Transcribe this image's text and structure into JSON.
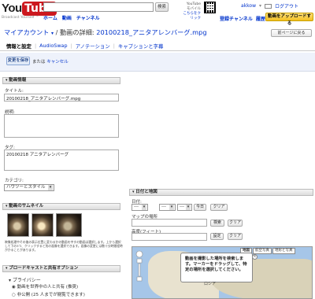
{
  "header": {
    "logo_you": "You",
    "logo_tube": "Tube",
    "logo_sub": "Broadcast Yourself ™",
    "search_button": "検索",
    "nav": [
      "ホーム",
      "動画",
      "チャンネル"
    ],
    "mobile_line1": "YouTube モバイル",
    "mobile_line2": "こちらをクリック",
    "username": "akkow",
    "logout": "ログアウト",
    "sub_nav": [
      "登録チャンネル",
      "履歴"
    ],
    "upload_button": "動画をアップロードする"
  },
  "title": {
    "account": "マイアカウント",
    "separator": "/",
    "section": "動画の詳細:",
    "filename": "20100218_アニタアレンバーグ.mpg",
    "back_button": "前ページに戻る"
  },
  "tabs": [
    {
      "label": "情報と設定",
      "active": true
    },
    {
      "label": "AudioSwap",
      "active": false
    },
    {
      "label": "アノテーション",
      "active": false
    },
    {
      "label": "キャプションと字幕",
      "active": false
    }
  ],
  "save": {
    "button": "変更を保存",
    "or": "または",
    "cancel": "キャンセル"
  },
  "video_info": {
    "header": "動画情報",
    "title_label": "タイトル:",
    "title_value": "20100218_アニタアレンバーグ.mpg",
    "desc_label": "説明:",
    "desc_value": "",
    "tags_label": "タグ:",
    "tags_value": "20100218 アニタアレンバーグ",
    "category_label": "カテゴリ:",
    "category_value": "ハウツーとスタイル"
  },
  "thumbnail": {
    "header": "動画のサムネイル",
    "note": "映像処理中その後の表示位置に変わるかの動画を中すの動画は選択します。上から選択して下の3つ、クリックすると別の画像を選択できます。画像の変更には数十分時間程時がかることがあります。"
  },
  "broadcast": {
    "header": "ブロードキャストと共有オプション",
    "privacy_label": "プライバシー",
    "option1": "動画を世界中の人と共有 (推奨)",
    "option2": "非公開 (25 人までが閲覧できます)"
  },
  "date_map": {
    "header": "日付と地図",
    "date_label": "日付:",
    "date_values": [
      "---",
      "---",
      "---"
    ],
    "today_button": "今日",
    "clear_button": "クリア",
    "location_label": "マップの場所",
    "search_button": "検索",
    "clear_button2": "クリア",
    "altitude_label": "高度(フィート)",
    "set_button": "設定",
    "clear_button3": "クリア",
    "map_types": [
      "地図",
      "航空写真",
      "地形と写真"
    ],
    "popup_text": "動画を撮影した場所を検索します。マーカーをドラッグして、特定の場所を選択してください。",
    "popup_close": "×",
    "map_place": "ロシア"
  }
}
